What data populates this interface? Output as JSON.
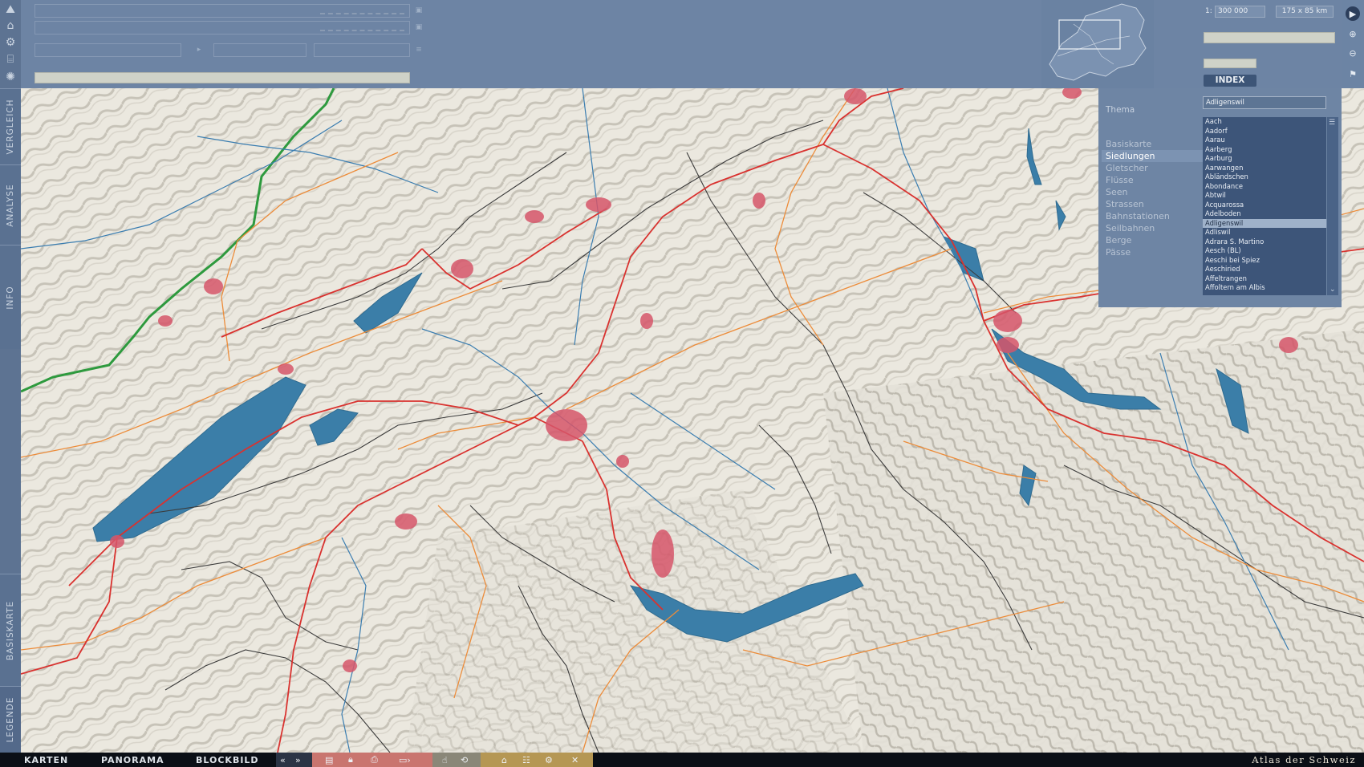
{
  "app": {
    "title": "Atlas der Schweiz"
  },
  "colors": {
    "sidebar": "#5d7392",
    "topbar": "#6d84a4",
    "lake": "#3b7ea8",
    "road": "#d9322f",
    "secondary_road": "#ec8c3a",
    "settlement": "#d6566a",
    "border": "#2e9a3e",
    "river": "#3a7db0"
  },
  "left_tools": [
    {
      "icon": "landscape-tool-icon",
      "glyph": "⛰"
    },
    {
      "icon": "buildings-tool-icon",
      "glyph": "⌂"
    },
    {
      "icon": "gear-tool-icon",
      "glyph": "⚙"
    },
    {
      "icon": "institution-tool-icon",
      "glyph": "⌸"
    },
    {
      "icon": "sun-tool-icon",
      "glyph": "✺"
    }
  ],
  "side_tabs": [
    "VERGLEICH",
    "ANALYSE",
    "INFO",
    "BASISKARTE",
    "LEGENDE"
  ],
  "top_fields": {
    "row1": "",
    "row2": "",
    "row3a": "",
    "row3b": "",
    "row3c": "",
    "row4": ""
  },
  "scale": {
    "prefix": "1:",
    "value": "300 000",
    "extent": "175 x 85 km"
  },
  "index_label": "INDEX",
  "theme_panel": {
    "label": "Thema",
    "items": [
      "Basiskarte",
      "Siedlungen",
      "Gletscher",
      "Flüsse",
      "Seen",
      "Strassen",
      "Bahnstationen",
      "Seilbahnen",
      "Berge",
      "Pässe"
    ],
    "selected": "Siedlungen"
  },
  "search": {
    "value": "Adligenswil"
  },
  "places": [
    "Aach",
    "Aadorf",
    "Aarau",
    "Aarberg",
    "Aarburg",
    "Aarwangen",
    "Abländschen",
    "Abondance",
    "Abtwil",
    "Acquarossa",
    "Adelboden",
    "Adligenswil",
    "Adliswil",
    "Adrara S. Martino",
    "Aesch (BL)",
    "Aeschi bei Spiez",
    "Aeschiried",
    "Affeltrangen",
    "Affoltern am Albis"
  ],
  "selected_place": "Adligenswil",
  "bottom_tabs": [
    "KARTEN",
    "PANORAMA",
    "BLOCKBILD"
  ],
  "brand": "Atlas der Schweiz",
  "bottom_icons": {
    "nav": [
      "rewind-icon",
      "fast-forward-icon"
    ],
    "red": [
      "print-icon",
      "lock-icon",
      "printer-icon",
      "export-icon"
    ],
    "grey": [
      "cursor-icon",
      "rotate-icon"
    ],
    "yellow": [
      "home-icon",
      "list-icon",
      "toggle-icon",
      "close-icon"
    ]
  }
}
